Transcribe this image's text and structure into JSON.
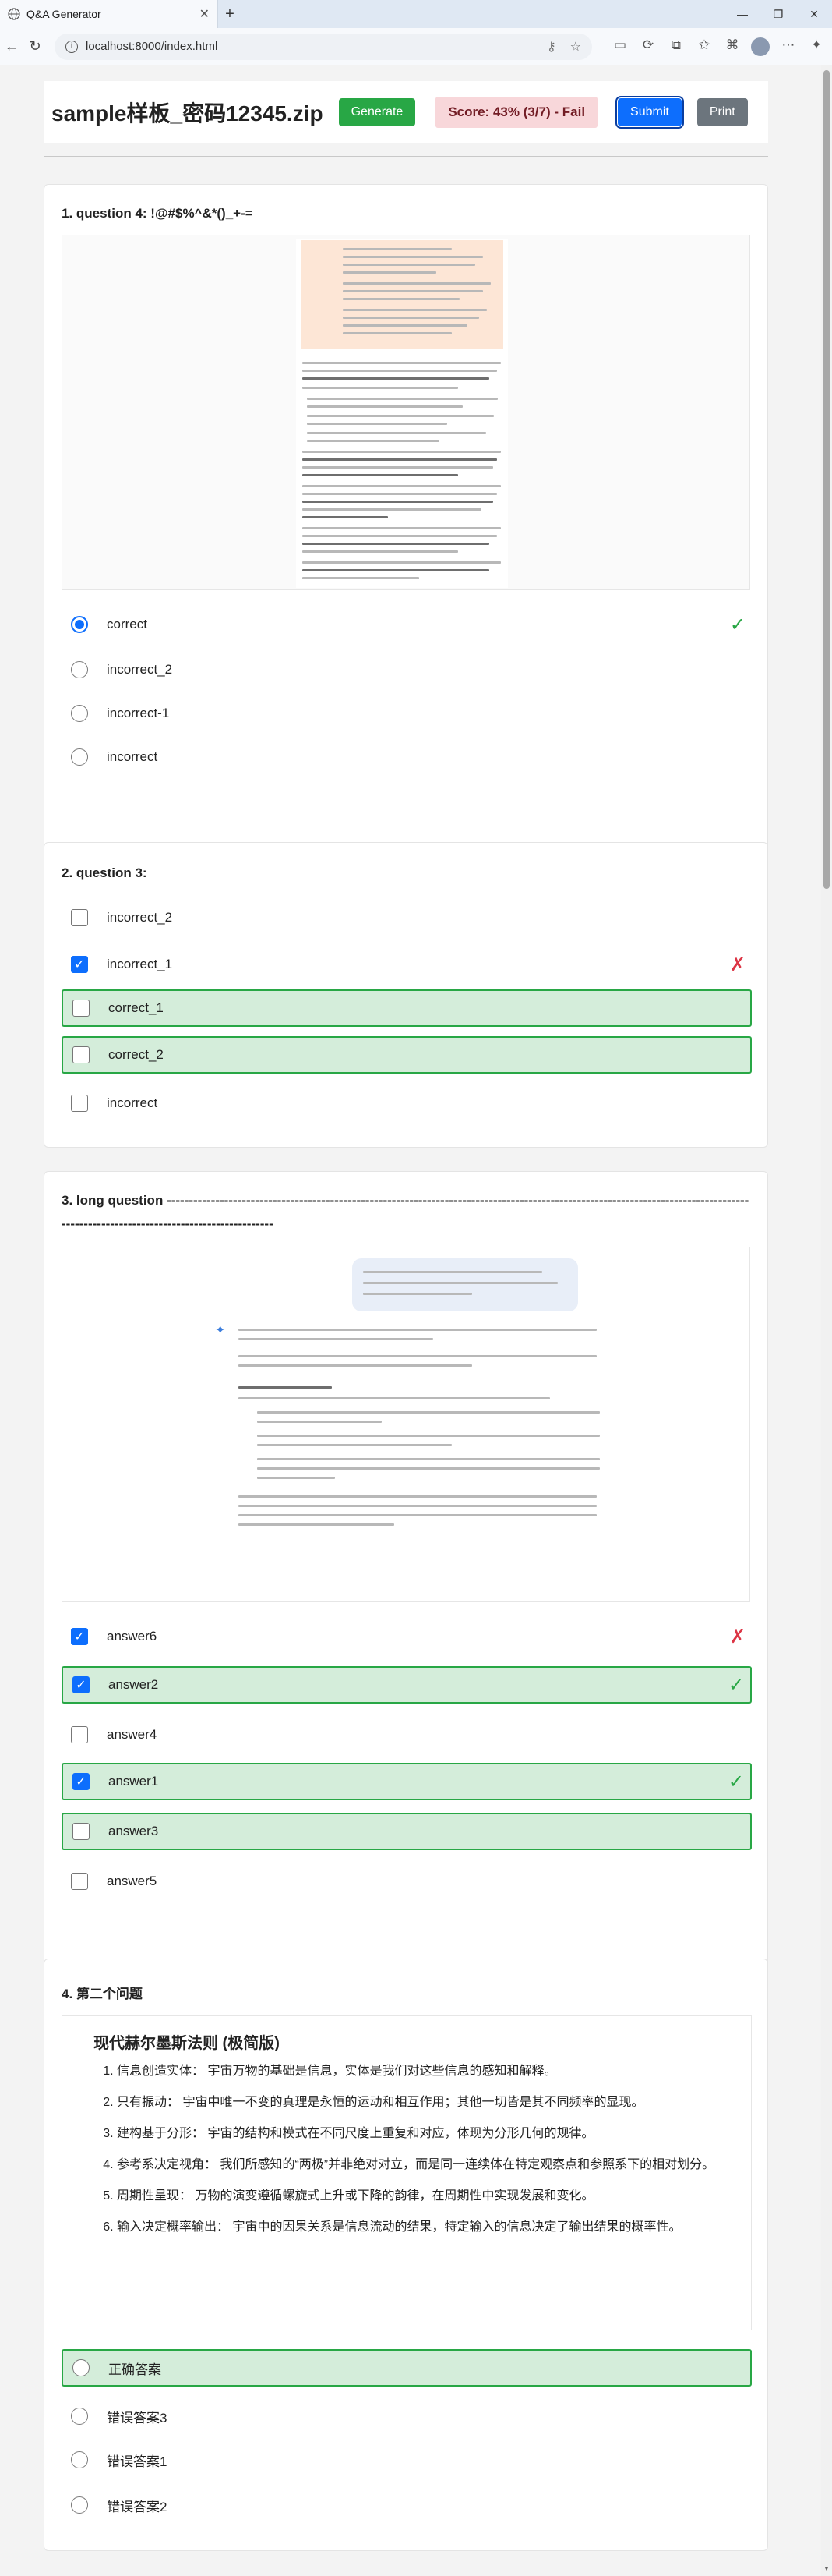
{
  "browser": {
    "tab_title": "Q&A Generator",
    "url": "localhost:8000/index.html"
  },
  "header": {
    "filename": "sample样板_密码12345.zip",
    "generate_label": "Generate",
    "score_text": "Score: 43% (3/7) - Fail",
    "submit_label": "Submit",
    "print_label": "Print"
  },
  "questions": [
    {
      "title": "1. question 4: !@#$%^&*()_+-=",
      "options": [
        "correct",
        "incorrect_2",
        "incorrect-1",
        "incorrect"
      ],
      "marks": [
        "✓"
      ]
    },
    {
      "title": "2. question 3:",
      "options": [
        "incorrect_2",
        "incorrect_1",
        "correct_1",
        "correct_2",
        "incorrect"
      ],
      "marks": [
        "✗"
      ]
    },
    {
      "title": "3. long question ------------------------------------------------------------------------------------------------------------------------------------------------------------------------------------",
      "options": [
        "answer6",
        "answer2",
        "answer4",
        "answer1",
        "answer3",
        "answer5"
      ],
      "marks": [
        "✗",
        "✓",
        "✓"
      ]
    },
    {
      "title": "4. 第二个问题",
      "rules_title": "现代赫尔墨斯法则 (极简版)",
      "rules": [
        "信息创造实体： 宇宙万物的基础是信息，实体是我们对这些信息的感知和解释。",
        "只有振动： 宇宙中唯一不变的真理是永恒的运动和相互作用；其他一切皆是其不同频率的显现。",
        "建构基于分形： 宇宙的结构和模式在不同尺度上重复和对应，体现为分形几何的规律。",
        "参考系决定视角： 我们所感知的“两极”并非绝对对立，而是同一连续体在特定观察点和参照系下的相对划分。",
        "周期性呈现： 万物的演变遵循螺旋式上升或下降的韵律，在周期性中实现发展和变化。",
        "输入决定概率输出： 宇宙中的因果关系是信息流动的结果，特定输入的信息决定了输出结果的概率性。"
      ],
      "options": [
        "正确答案",
        "错误答案3",
        "错误答案1",
        "错误答案2"
      ]
    }
  ],
  "colors": {
    "correct_bg": "#d4edda",
    "correct_border": "#28a745",
    "wrong_mark": "#dc3545",
    "primary": "#0d6efd",
    "fail_bg": "#f8d7da"
  }
}
